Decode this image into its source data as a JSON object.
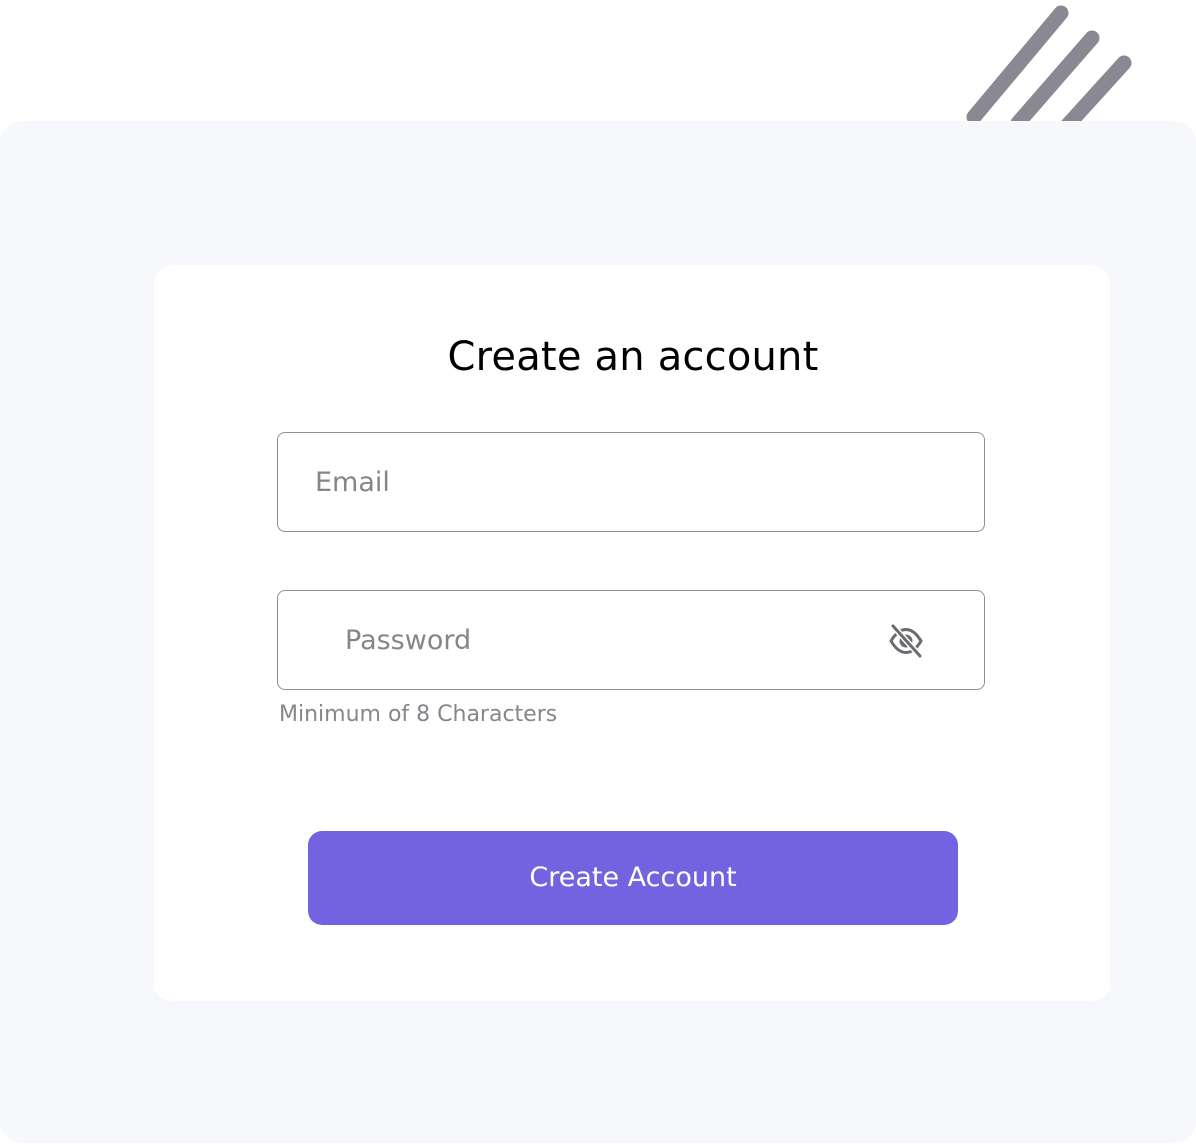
{
  "title": "Create an account",
  "email": {
    "placeholder": "Email",
    "value": ""
  },
  "password": {
    "placeholder": "Password",
    "value": "",
    "hint": "Minimum of 8 Characters",
    "toggle_icon": "eye-off-icon"
  },
  "submit": {
    "label": "Create Account"
  },
  "colors": {
    "accent": "#7463E1",
    "panel": "#F7F8FC",
    "decor": "#8A8892"
  }
}
